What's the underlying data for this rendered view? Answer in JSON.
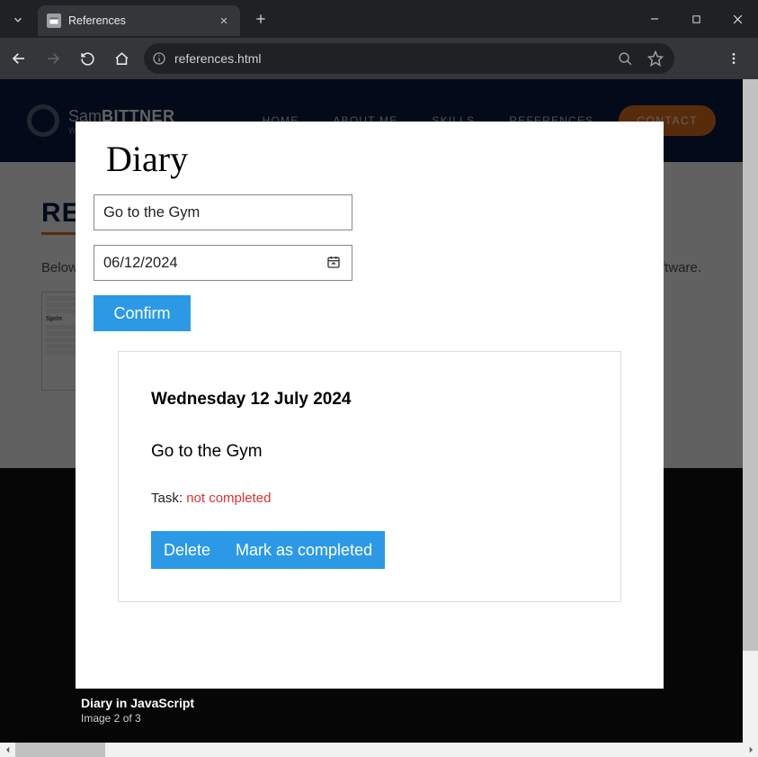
{
  "browser": {
    "tab_title": "References",
    "url": "references.html"
  },
  "background": {
    "brand_light": "Sam",
    "brand_bold": "BITTNER",
    "brand_sub": "W",
    "nav": [
      "HOME",
      "ABOUT ME",
      "SKILLS",
      "REFERENCES"
    ],
    "contact": "CONTACT",
    "heading_partial": "RE",
    "lead_partial_left": "Below,",
    "lead_partial_right": "oftware.",
    "thumb_title": "Sprin"
  },
  "modal": {
    "title": "Diary",
    "task_input": "Go to the Gym",
    "date_input": "06/12/2024",
    "confirm": "Confirm",
    "entry": {
      "date_heading": "Wednesday 12 July 2024",
      "task_text": "Go to the Gym",
      "status_label": "Task: ",
      "status_value": "not completed",
      "delete": "Delete",
      "mark": "Mark as completed"
    }
  },
  "caption": {
    "title": "Diary in JavaScript",
    "sub": "Image 2 of 3"
  }
}
